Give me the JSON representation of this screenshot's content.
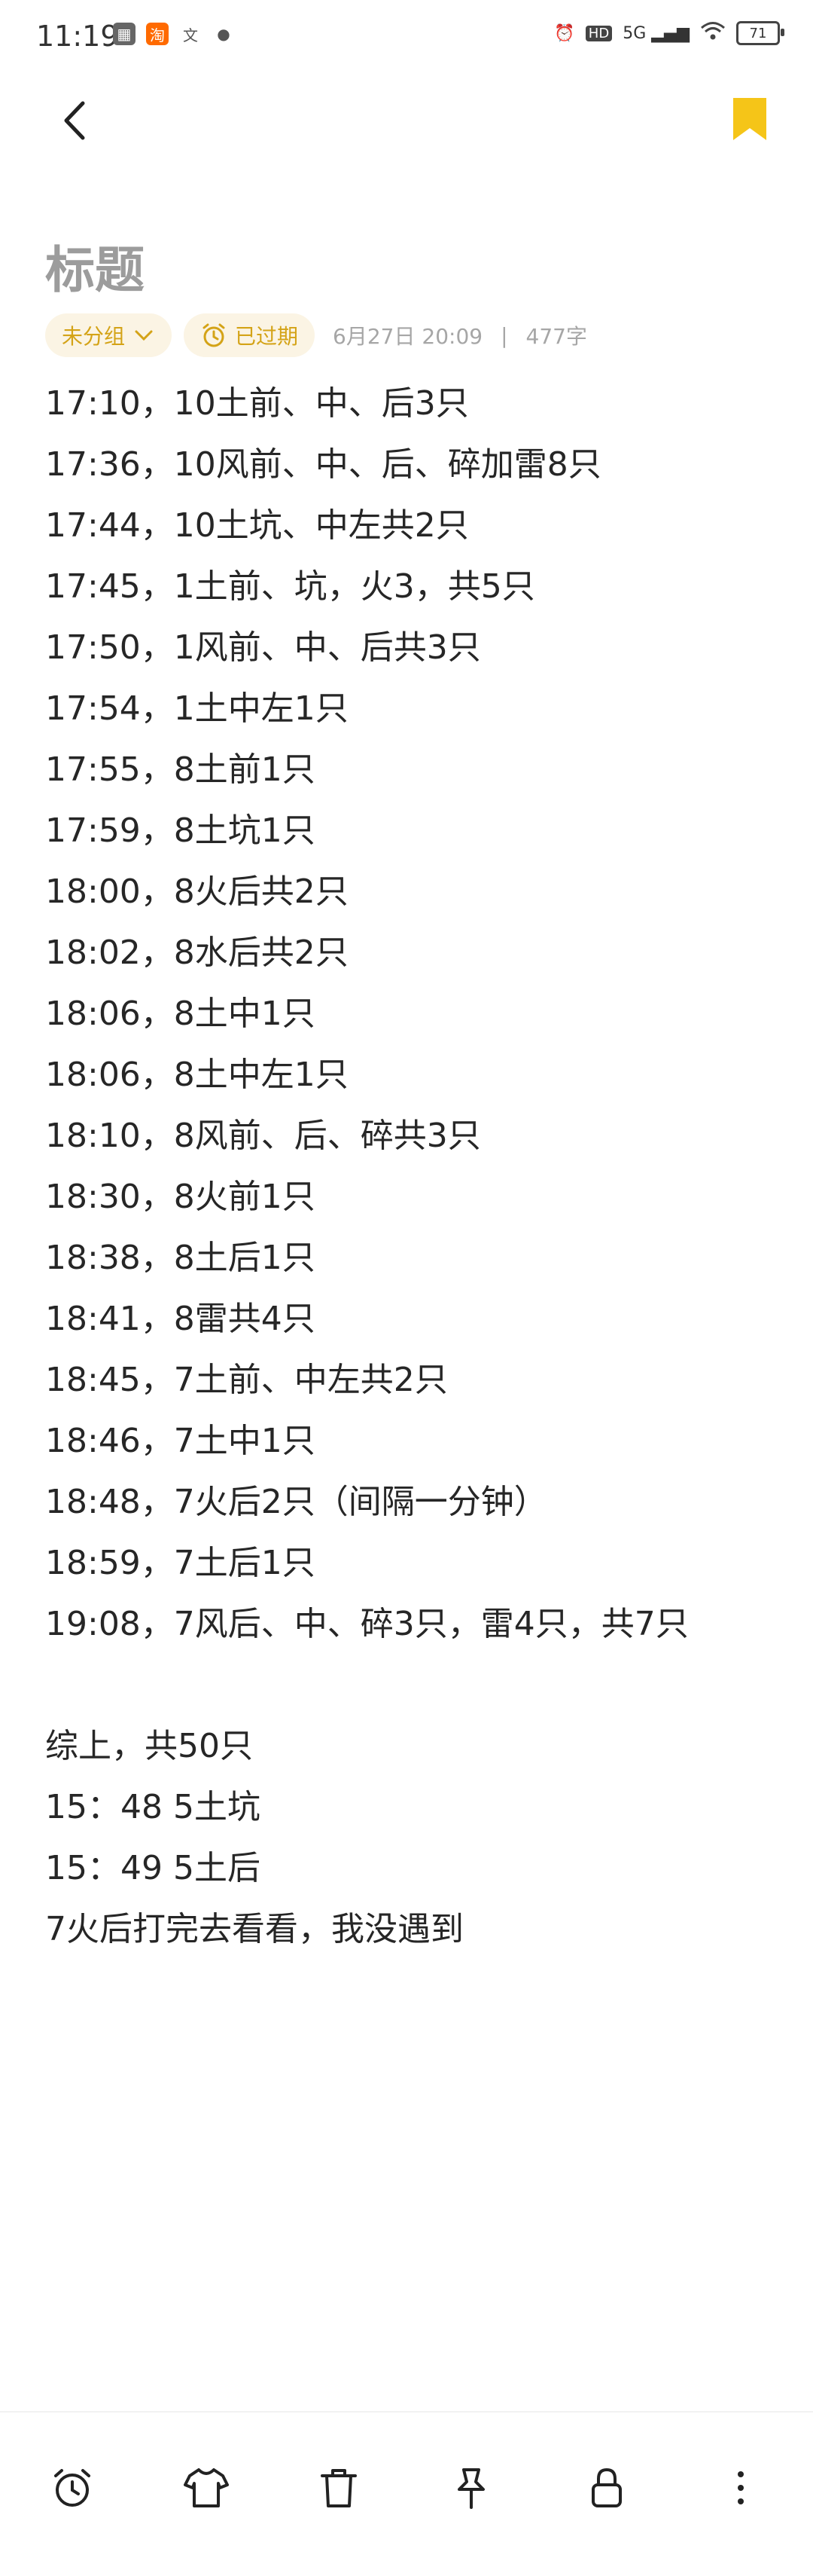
{
  "status_bar": {
    "time": "11:19",
    "left_icons": [
      "notification-icon",
      "taobao-icon",
      "translate-icon",
      "chat-icon"
    ],
    "network": "5G",
    "hd": "HD",
    "battery": "71"
  },
  "header": {
    "back_icon": "chevron-left-icon",
    "bookmark_icon": "bookmark-icon",
    "accent_color": "#f5c518"
  },
  "note": {
    "title": "标题",
    "group_label": "未分组",
    "reminder_label": "已过期",
    "date": "6月27日 20:09",
    "separator": "|",
    "word_count": "477字",
    "lines": [
      "17:10，10土前、中、后3只",
      "17:36，10风前、中、后、碎加雷8只",
      "17:44，10土坑、中左共2只",
      "17:45，1土前、坑，火3，共5只",
      "17:50，1风前、中、后共3只",
      "17:54，1土中左1只",
      "17:55，8土前1只",
      "17:59，8土坑1只",
      "18:00，8火后共2只",
      "18:02，8水后共2只",
      "18:06，8土中1只",
      "18:06，8土中左1只",
      "18:10，8风前、后、碎共3只",
      "18:30，8火前1只",
      "18:38，8土后1只",
      "18:41，8雷共4只",
      "18:45，7土前、中左共2只",
      "18:46，7土中1只",
      "18:48，7火后2只（间隔一分钟）",
      "18:59，7土后1只",
      "19:08，7风后、中、碎3只，雷4只，共7只",
      "",
      "综上，共50只",
      "15：48   5土坑",
      "15：49   5土后",
      "7火后打完去看看，我没遇到"
    ]
  },
  "toolbar": {
    "icons": [
      "alarm-icon",
      "shirt-icon",
      "trash-icon",
      "pin-icon",
      "lock-icon",
      "more-icon"
    ]
  }
}
